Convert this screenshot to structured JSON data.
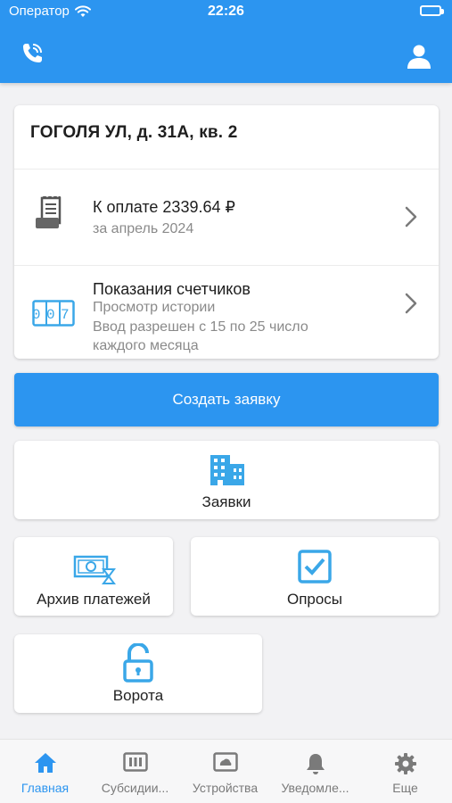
{
  "status_bar": {
    "carrier": "Оператор",
    "time": "22:26"
  },
  "address_card": {
    "address": "ГОГОЛЯ УЛ, д. 31А, кв. 2",
    "payment": {
      "title": "К оплате 2339.64 ₽",
      "subtitle": "за апрель 2024",
      "icon": "receipt-icon"
    },
    "meters": {
      "title": "Показания счетчиков",
      "subtitle": "Просмотр истории",
      "note": "Ввод разрешен с 15 по 25 число каждого месяца",
      "icon": "meter-counter-icon",
      "counter_digits": "007"
    }
  },
  "create_request_label": "Создать заявку",
  "tiles": {
    "requests": "Заявки",
    "payments_archive": "Архив платежей",
    "polls": "Опросы",
    "gates": "Ворота"
  },
  "bottom_nav": [
    {
      "label": "Главная",
      "icon": "home-icon",
      "active": true
    },
    {
      "label": "Субсидии...",
      "icon": "subsidy-icon",
      "active": false
    },
    {
      "label": "Устройства",
      "icon": "devices-icon",
      "active": false
    },
    {
      "label": "Уведомле...",
      "icon": "bell-icon",
      "active": false
    },
    {
      "label": "Еще",
      "icon": "gear-icon",
      "active": false
    }
  ],
  "colors": {
    "accent": "#2c95f0",
    "icon_light_blue": "#3aa7e8",
    "inactive": "#7a7a7a"
  }
}
